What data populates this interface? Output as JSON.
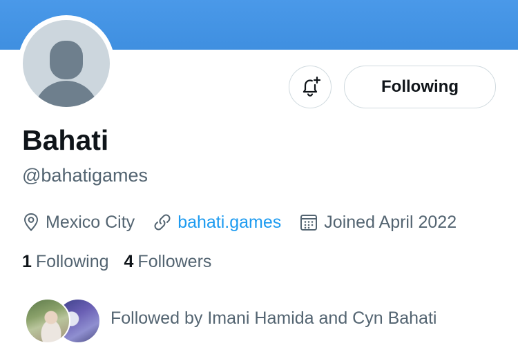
{
  "profile": {
    "display_name": "Bahati",
    "handle": "@bahatigames",
    "location": "Mexico City",
    "website": "bahati.games",
    "joined": "Joined April 2022"
  },
  "actions": {
    "following_label": "Following"
  },
  "stats": {
    "following_count": "1",
    "following_label": "Following",
    "followers_count": "4",
    "followers_label": "Followers"
  },
  "followed_by": {
    "text": "Followed by Imani Hamida and Cyn Bahati"
  },
  "colors": {
    "banner": "#4a99e9",
    "link": "#1d9bf0",
    "primary_text": "#0f1419",
    "secondary_text": "#536471",
    "border": "#cfd9de"
  },
  "icons": {
    "notify": "bell-plus-icon",
    "location": "location-pin-icon",
    "website": "link-icon",
    "joined": "calendar-icon"
  }
}
